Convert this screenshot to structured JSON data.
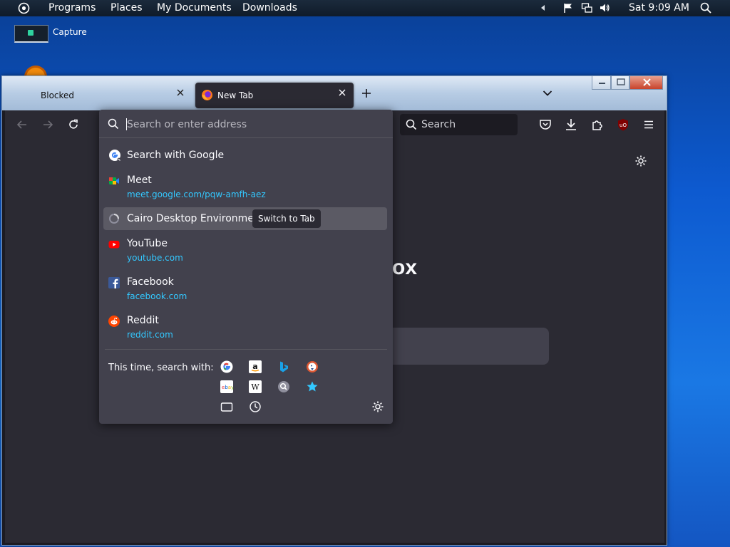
{
  "panel": {
    "menu": [
      "Programs",
      "Places",
      "My Documents",
      "Downloads"
    ],
    "clock": "Sat 9:09 AM"
  },
  "desktop": {
    "capture_label": "Capture"
  },
  "browser": {
    "tabs": [
      {
        "title": "Blocked",
        "active": false
      },
      {
        "title": "New Tab",
        "active": true
      }
    ],
    "search_placeholder": "Search",
    "content_brand": "ox"
  },
  "urlbar": {
    "placeholder": "Search or enter address",
    "results": [
      {
        "icon": "google-icon",
        "title": "Search with Google",
        "url": ""
      },
      {
        "icon": "meet-icon",
        "title": "Meet",
        "url": "meet.google.com/pqw-amfh-aez"
      },
      {
        "icon": "loading-icon",
        "title": "Cairo Desktop Environment",
        "url": "",
        "action": "Switch to Tab",
        "selected": true
      },
      {
        "icon": "youtube-icon",
        "title": "YouTube",
        "url": "youtube.com"
      },
      {
        "icon": "facebook-icon",
        "title": "Facebook",
        "url": "facebook.com"
      },
      {
        "icon": "reddit-icon",
        "title": "Reddit",
        "url": "reddit.com"
      }
    ],
    "oneoff_label": "This time, search with:",
    "engines": [
      "google-icon",
      "amazon-icon",
      "bing-icon",
      "duckduckgo-icon",
      "ebay-icon",
      "wikipedia-icon",
      "search-engine-icon",
      "bookmark-star-icon",
      "tabs-icon",
      "history-icon"
    ]
  },
  "colors": {
    "panel_bg": "#0f1b29",
    "desktop_blue": "#0d5ad0",
    "toolbar": "#2b2a33",
    "dropdown": "#42414d",
    "link": "#33c8ff",
    "selected_row": "#5b5a64"
  }
}
